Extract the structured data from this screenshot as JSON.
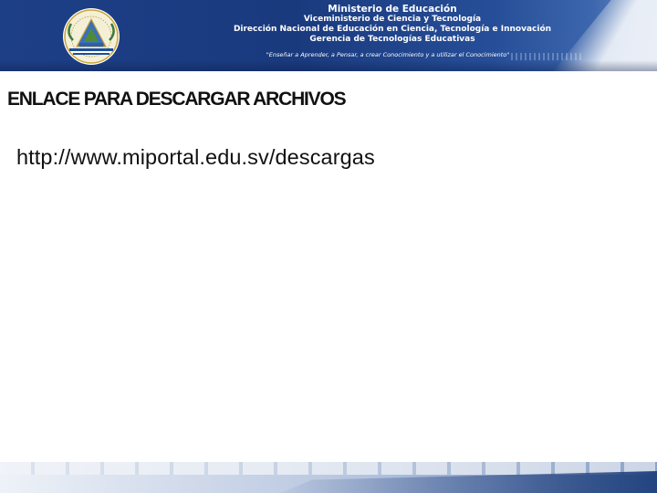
{
  "header": {
    "line1": "Ministerio de Educación",
    "line2": "Viceministerio de Ciencia y Tecnología",
    "line3": "Dirección Nacional de Educación en Ciencia, Tecnología e Innovación",
    "line4": "Gerencia de Tecnologías Educativas",
    "motto": "\"Enseñar a Aprender, a Pensar, a crear Conocimiento y a utilizar el Conocimiento\""
  },
  "slide": {
    "title": "ENLACE PARA DESCARGAR ARCHIVOS",
    "link_text": "http://www.miportal.edu.sv/descargas"
  },
  "colors": {
    "banner_blue": "#1d3f86",
    "text": "#111111"
  },
  "icons": {
    "seal": "coat-of-arms-el-salvador-icon"
  }
}
